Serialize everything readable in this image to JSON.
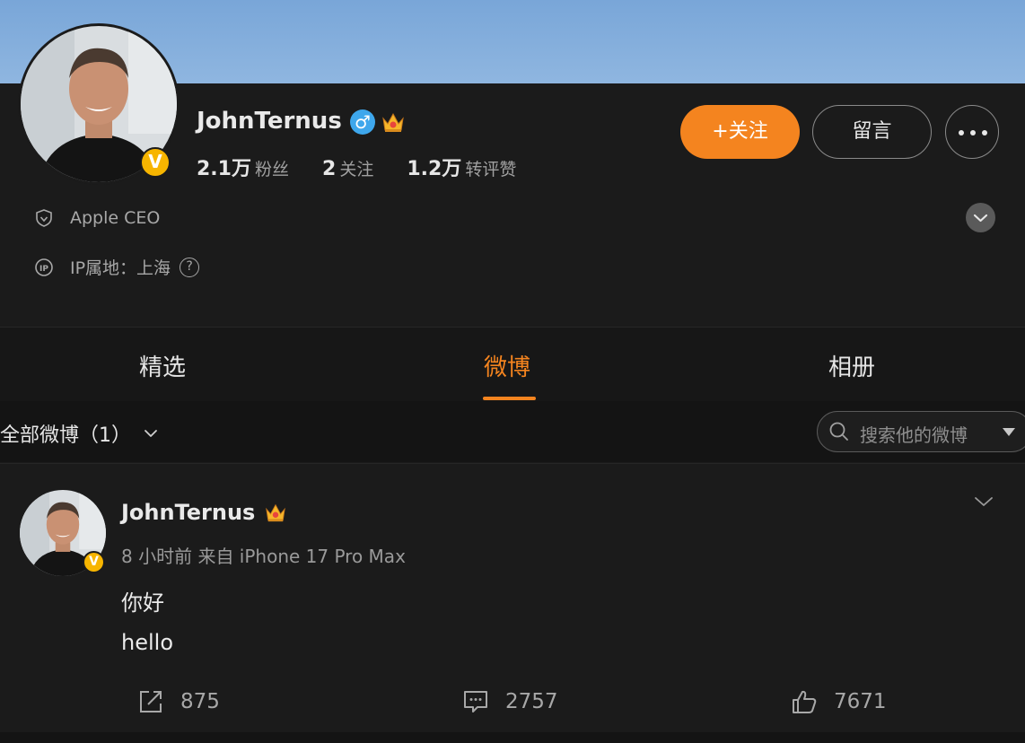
{
  "profile": {
    "name": "JohnTernus",
    "gender_symbol": "♂",
    "verified_badge": "V",
    "stats": [
      {
        "value": "2.1万",
        "label": "粉丝"
      },
      {
        "value": "2",
        "label": "关注"
      },
      {
        "value": "1.2万",
        "label": "转评赞"
      }
    ],
    "bio": "Apple CEO",
    "ip_location": "IP属地：上海",
    "help_symbol": "?"
  },
  "actions": {
    "follow_label": "+关注",
    "message_label": "留言"
  },
  "tabs": [
    {
      "label": "精选",
      "active": false
    },
    {
      "label": "微博",
      "active": true
    },
    {
      "label": "相册",
      "active": false
    }
  ],
  "filter": {
    "label": "全部微博（1）",
    "search_placeholder": "搜索他的微博"
  },
  "post": {
    "author": "JohnTernus",
    "verified_badge": "V",
    "meta": "8 小时前  来自 iPhone 17 Pro Max",
    "lines": [
      "你好",
      "hello"
    ],
    "reposts": "875",
    "comments": "2757",
    "likes": "7671"
  },
  "colors": {
    "accent": "#f4841f",
    "verified": "#f7b500",
    "gender": "#3ea7ec",
    "background": "#1b1b1b"
  },
  "icons": [
    "shield-icon",
    "ip-icon",
    "help-icon",
    "chevron-down-icon",
    "search-icon",
    "more-icon",
    "share-icon",
    "comment-icon",
    "like-icon",
    "crown-icon"
  ]
}
